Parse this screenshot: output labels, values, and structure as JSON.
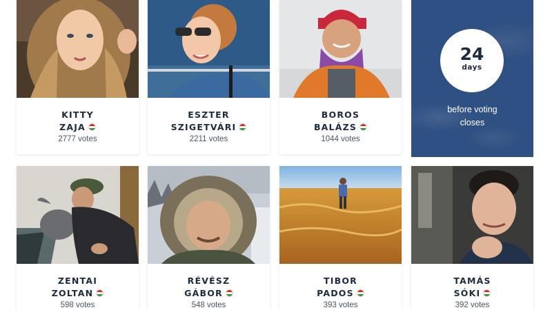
{
  "countdown": {
    "number": "24",
    "unit": "days",
    "line1": "before voting",
    "line2": "closes"
  },
  "candidates": [
    {
      "first": "KITTY",
      "last": "ZAJA",
      "votes": "2777 votes",
      "photo": "portrait-kitty-zaja"
    },
    {
      "first": "ESZTER",
      "last": "SZIGETVÁRI",
      "votes": "2211 votes",
      "photo": "portrait-eszter-szigetvari"
    },
    {
      "first": "BOROS",
      "last": "BALÁZS",
      "votes": "1044 votes",
      "photo": "portrait-boros-balazs"
    },
    {
      "first": "ZENTAI",
      "last": "ZOLTAN",
      "votes": "598 votes",
      "photo": "portrait-zentai-zoltan"
    },
    {
      "first": "RÉVÉSZ",
      "last": "GÁBOR",
      "votes": "548 votes",
      "photo": "portrait-revesz-gabor"
    },
    {
      "first": "TIBOR",
      "last": "PADOS",
      "votes": "393 votes",
      "photo": "portrait-tibor-pados"
    },
    {
      "first": "TAMÁS",
      "last": "SÓKI",
      "votes": "392 votes",
      "photo": "portrait-tamas-soki"
    }
  ],
  "colors": {
    "navy_text": "#1c2b3e",
    "countdown_bg": "#2f5083",
    "flag": [
      "#d52b1e",
      "#ffffff",
      "#3f8f3a"
    ]
  },
  "icons": {
    "flag": "hungary-flag-icon"
  }
}
